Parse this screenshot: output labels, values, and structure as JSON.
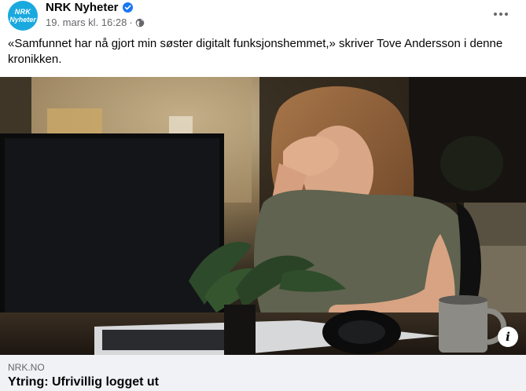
{
  "post": {
    "author": "NRK Nyheter",
    "avatar_text_top": "NRK",
    "avatar_text_bottom": "Nyheter",
    "avatar_color": "#1aa9df",
    "timestamp": "19. mars kl. 16:28",
    "separator": "·",
    "audience_icon": "globe-icon",
    "verified_icon": "verified-badge-icon",
    "more_icon": "more-options-icon",
    "caption": "«Samfunnet har nå gjort min søster digitalt funksjonshemmet,» skriver Tove Andersson i denne kronikken."
  },
  "link_preview": {
    "domain": "NRK.NO",
    "title": "Ytring: Ufrivillig logget ut",
    "info_label": "i",
    "info_icon": "info-icon"
  },
  "colors": {
    "verified": "#1877f2",
    "secondary_text": "#65676b",
    "link_box_bg": "#f0f2f5"
  }
}
